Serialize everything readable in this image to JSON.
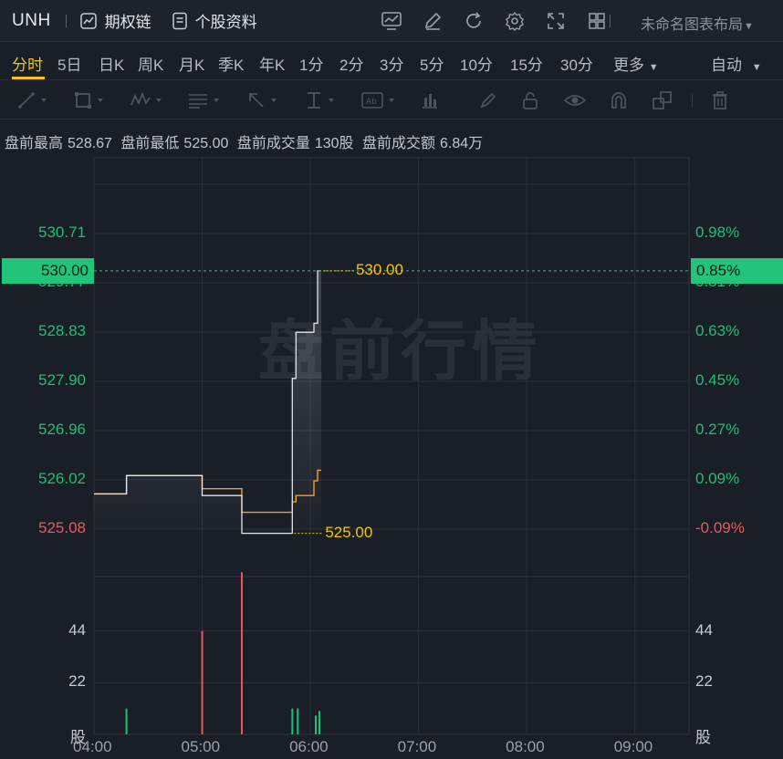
{
  "header": {
    "ticker": "UNH",
    "options_chain": "期权链",
    "stock_profile": "个股资料",
    "layout_name": "未命名图表布局",
    "icons": [
      "indicator-chart-icon",
      "draw-pen-icon",
      "refresh-icon",
      "settings-gear-icon",
      "fullscreen-icon",
      "grid-layout-icon"
    ]
  },
  "periods": {
    "tabs": [
      "分时",
      "5日",
      "日K",
      "周K",
      "月K",
      "季K",
      "年K",
      "1分",
      "2分",
      "3分",
      "5分",
      "10分",
      "15分",
      "30分",
      "更多"
    ],
    "active": "分时",
    "auto": "自动"
  },
  "drawing_tools": [
    "trend-line-icon",
    "rectangle-icon",
    "wave-pattern-icon",
    "fibonacci-icon",
    "arrow-icon",
    "price-range-icon",
    "text-label-icon",
    "bar-measure-icon",
    "brush-icon",
    "lock-icon",
    "eye-icon",
    "magnet-icon",
    "layers-icon",
    "trash-icon"
  ],
  "stats": {
    "high_label": "盘前最高",
    "high": "528.67",
    "low_label": "盘前最低",
    "low": "525.00",
    "vol_label": "盘前成交量",
    "vol": "130股",
    "amt_label": "盘前成交额",
    "amt": "6.84万"
  },
  "watermark": "盘前行情",
  "colors": {
    "up": "#1fbf75",
    "down": "#e85a5a",
    "accent": "#f0c419",
    "price_line": "#e2e5ea",
    "avg_line": "#f0a030"
  },
  "chart_data": {
    "type": "line",
    "x_ticks": [
      "04:00",
      "05:00",
      "06:00",
      "07:00",
      "08:00",
      "09:00"
    ],
    "x_range": [
      "04:00",
      "09:30"
    ],
    "price_ticks": [
      "530.71",
      "529.77",
      "528.83",
      "527.90",
      "526.96",
      "526.02",
      "525.08"
    ],
    "pct_ticks": [
      "0.98%",
      "0.81%",
      "0.63%",
      "0.45%",
      "0.27%",
      "0.09%",
      "-0.09%"
    ],
    "price_range": [
      525.08,
      530.71
    ],
    "current_price": "530.00",
    "current_pct": "0.85%",
    "max_label": "530.00",
    "min_label": "525.00",
    "volume_ticks": [
      "44",
      "22",
      "股"
    ],
    "volume_range": [
      0,
      66
    ],
    "series": [
      {
        "points": [
          [
            "04:00",
            525.75
          ],
          [
            "04:18",
            525.75
          ],
          [
            "04:18",
            526.1
          ],
          [
            "05:00",
            526.1
          ],
          [
            "05:00",
            525.72
          ],
          [
            "05:22",
            525.72
          ],
          [
            "05:22",
            525.0
          ],
          [
            "05:50",
            525.0
          ],
          [
            "05:50",
            527.95
          ],
          [
            "05:52",
            527.95
          ],
          [
            "05:52",
            528.83
          ],
          [
            "06:02",
            528.83
          ],
          [
            "06:02",
            529.0
          ],
          [
            "06:04",
            529.0
          ],
          [
            "06:04",
            530.0
          ],
          [
            "06:06",
            530.0
          ]
        ]
      },
      {
        "points": [
          [
            "04:00",
            525.75
          ],
          [
            "04:18",
            525.75
          ],
          [
            "04:18",
            526.1
          ],
          [
            "05:00",
            526.1
          ],
          [
            "05:00",
            525.85
          ],
          [
            "05:22",
            525.85
          ],
          [
            "05:22",
            525.4
          ],
          [
            "05:50",
            525.4
          ],
          [
            "05:50",
            525.6
          ],
          [
            "05:52",
            525.6
          ],
          [
            "05:52",
            525.72
          ],
          [
            "06:02",
            525.72
          ],
          [
            "06:02",
            526.0
          ],
          [
            "06:04",
            526.0
          ],
          [
            "06:04",
            526.2
          ],
          [
            "06:06",
            526.2
          ]
        ]
      }
    ],
    "volume": [
      {
        "t": "04:18",
        "v": 11,
        "dir": "up"
      },
      {
        "t": "05:00",
        "v": 44,
        "dir": "down"
      },
      {
        "t": "05:22",
        "v": 69,
        "dir": "down"
      },
      {
        "t": "05:50",
        "v": 11,
        "dir": "up"
      },
      {
        "t": "05:53",
        "v": 11,
        "dir": "up"
      },
      {
        "t": "06:03",
        "v": 8,
        "dir": "up"
      },
      {
        "t": "06:05",
        "v": 10,
        "dir": "up"
      }
    ]
  }
}
